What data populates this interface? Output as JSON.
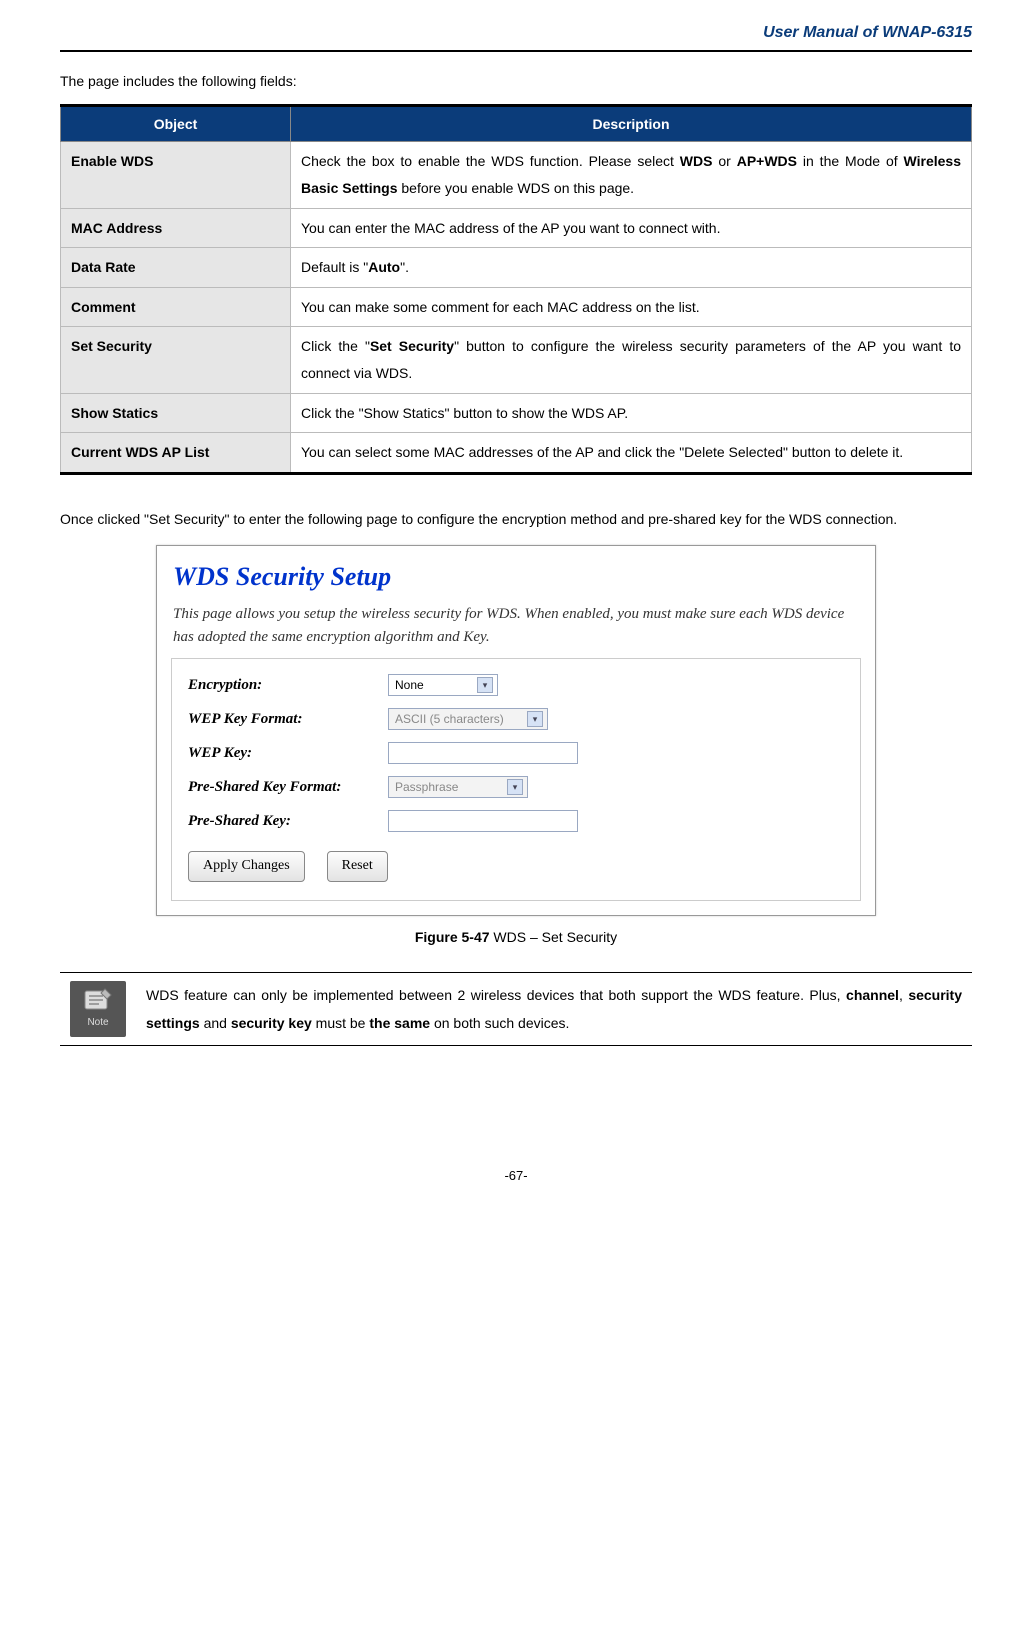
{
  "header": {
    "title": "User Manual of WNAP-6315"
  },
  "intro": "The page includes the following fields:",
  "table": {
    "headers": {
      "object": "Object",
      "description": "Description"
    },
    "rows": [
      {
        "object": "Enable WDS",
        "desc_html": "Check the box to enable the WDS function. Please select <b>WDS</b> or <b>AP+WDS</b> in the Mode of <b>Wireless Basic Settings</b> before you enable WDS on this page."
      },
      {
        "object": "MAC Address",
        "desc_html": "You can enter the MAC address of the AP you want to connect with."
      },
      {
        "object": "Data Rate",
        "desc_html": "Default is \"<b>Auto</b>\"."
      },
      {
        "object": "Comment",
        "desc_html": "You can make some comment for each MAC address on the list."
      },
      {
        "object": "Set Security",
        "desc_html": "Click the \"<b>Set Security</b>\" button to configure the wireless security parameters of the AP you want to connect via WDS."
      },
      {
        "object": "Show Statics",
        "desc_html": "Click the \"Show Statics\" button to show the WDS AP."
      },
      {
        "object": "Current WDS AP List",
        "desc_html": "You can select some MAC addresses of the AP and click the \"Delete Selected\" button to delete it."
      }
    ]
  },
  "body_para": "Once clicked \"Set Security\" to enter the following page to configure the encryption method and pre-shared key for the WDS connection.",
  "screenshot": {
    "title": "WDS Security Setup",
    "subtitle": "This page allows you setup the wireless security for WDS. When enabled, you must make sure each WDS device has adopted the same encryption algorithm and Key.",
    "rows": {
      "encryption": {
        "label": "Encryption:",
        "value": "None"
      },
      "wep_format": {
        "label": "WEP Key Format:",
        "value": "ASCII (5 characters)"
      },
      "wep_key": {
        "label": "WEP Key:",
        "value": ""
      },
      "psk_format": {
        "label": "Pre-Shared Key Format:",
        "value": "Passphrase"
      },
      "psk": {
        "label": "Pre-Shared Key:",
        "value": ""
      }
    },
    "buttons": {
      "apply": "Apply Changes",
      "reset": "Reset"
    }
  },
  "figure": {
    "label": "Figure 5-47",
    "caption": " WDS – Set Security"
  },
  "note": {
    "icon_label": "Note",
    "text_html": "WDS feature can only be implemented between 2 wireless devices that both support the WDS feature. Plus, <b>channel</b>, <b>security settings</b> and <b>security key</b> must be <b>the same</b> on both such devices."
  },
  "footer": {
    "page": "-67-"
  }
}
